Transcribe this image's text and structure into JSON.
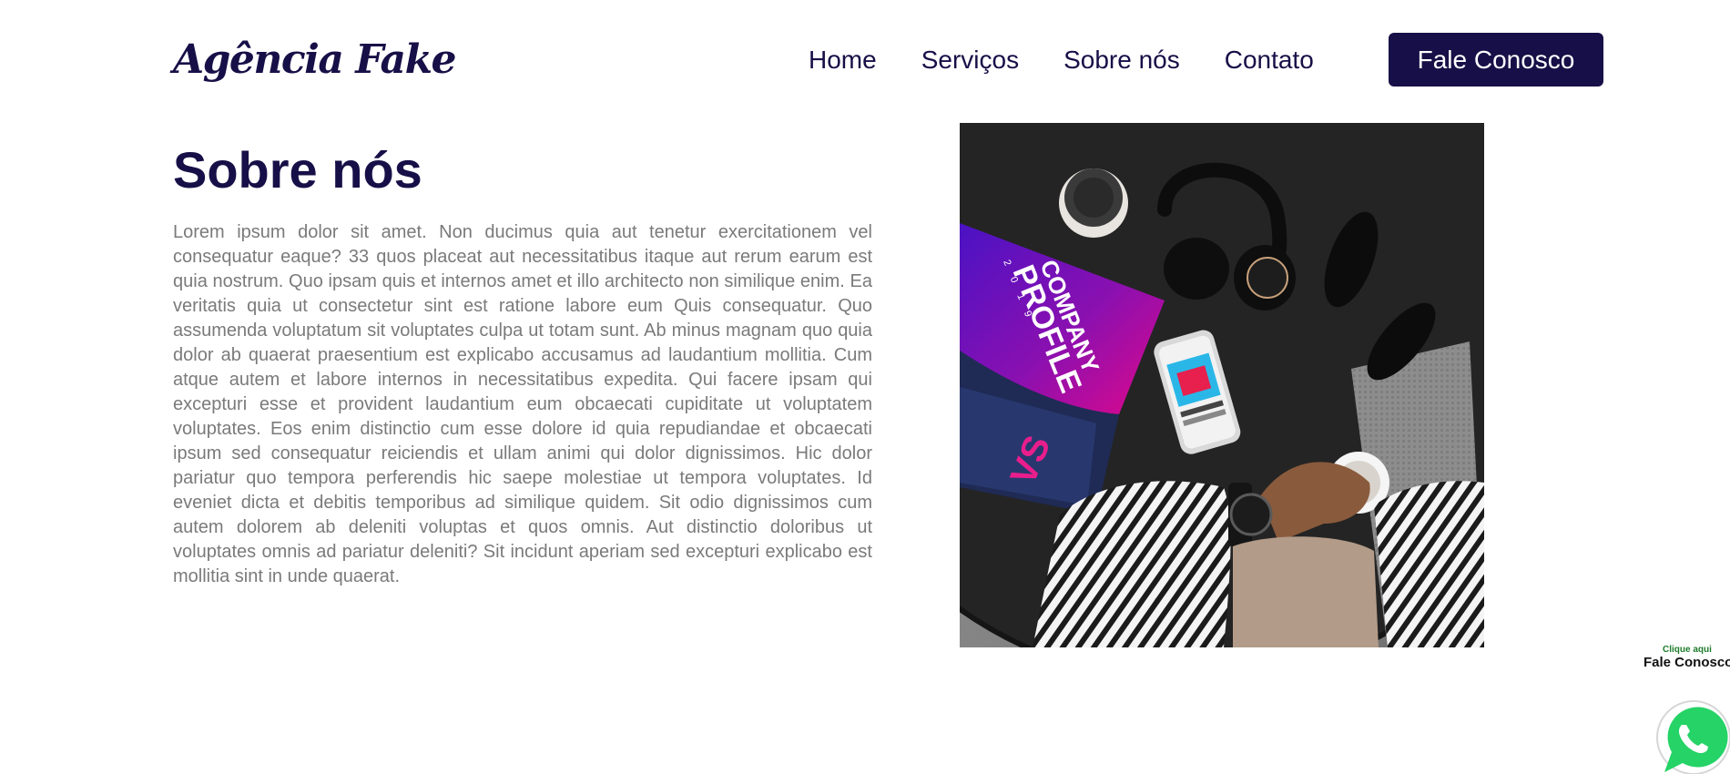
{
  "header": {
    "logo_text": "Agência Fake",
    "nav": [
      "Home",
      "Serviços",
      "Sobre nós",
      "Contato"
    ],
    "cta_label": "Fale Conosco"
  },
  "about": {
    "title": "Sobre nós",
    "paragraph": "Lorem ipsum dolor sit amet. Non ducimus quia aut tenetur exercitationem vel consequatur eaque? 33 quos placeat aut necessitatibus itaque aut rerum earum est quia nostrum. Quo ipsam quis et internos amet et illo architecto non similique enim. Ea veritatis quia ut consectetur sint est ratione labore eum Quis consequatur. Quo assumenda voluptatum sit voluptates culpa ut totam sunt. Ab minus magnam quo quia dolor ab quaerat praesentium est explicabo accusamus ad laudantium mollitia. Cum atque autem et labore internos in necessitatibus expedita. Qui facere ipsam qui excepturi esse et provident laudantium eum obcaecati cupiditate ut voluptatem voluptates. Eos enim distinctio cum esse dolore id quia repudiandae et obcaecati ipsum sed consequatur reiciendis et ullam animi qui dolor dignissimos. Hic dolor pariatur quo tempora perferendis hic saepe molestiae ut tempora voluptates. Id eveniet dicta et debitis temporibus ad similique quidem. Sit odio dignissimos cum autem dolorem ab deleniti voluptas et quos omnis. Aut distinctio doloribus ut voluptates omnis ad pariatur deleniti? Sit incidunt aperiam sed excepturi explicabo est mollitia sint in unde quaerat.",
    "image": {
      "subject": "flat-lay desk photo",
      "booklet_line1": "COMPANY",
      "booklet_line2": "PROFILE",
      "booklet_year": "2019",
      "booklet_mark": "VS"
    }
  },
  "whatsapp": {
    "small_label": "Clique aqui",
    "big_label": "Fale Conosco",
    "icon": "whatsapp-icon"
  },
  "colors": {
    "brand": "#170f47",
    "text_muted": "#7a7a7a",
    "whatsapp_green": "#25d366",
    "booklet_purple": "#5a16c9",
    "booklet_magenta": "#d60a8f"
  }
}
